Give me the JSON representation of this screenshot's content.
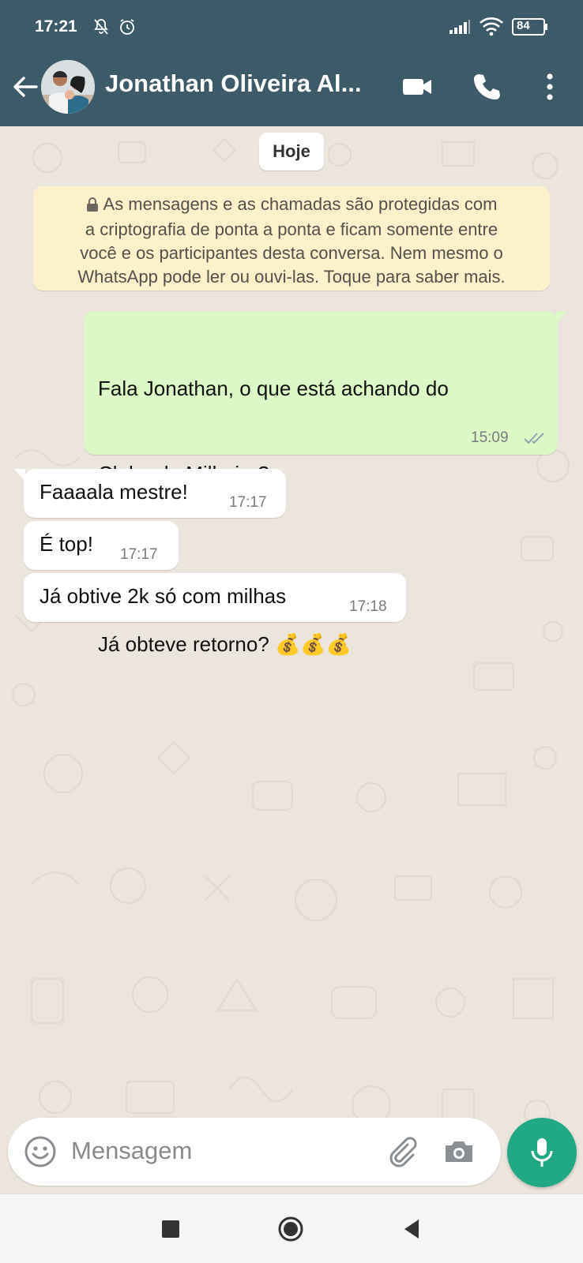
{
  "status_bar": {
    "time": "17:21",
    "battery": "84",
    "icons": [
      "bell-off-icon",
      "alarm-icon",
      "signal-icon",
      "wifi-icon",
      "battery-icon"
    ]
  },
  "header": {
    "contact_name": "Jonathan Oliveira Al...",
    "icons": [
      "back-arrow-icon",
      "video-call-icon",
      "phone-icon",
      "more-vert-icon"
    ]
  },
  "chat": {
    "date_chip": "Hoje",
    "encryption_notice": {
      "lines": [
        "As mensagens e as chamadas são protegidas com",
        "a criptografia de ponta a ponta e ficam somente entre",
        "você e os participantes desta conversa. Nem mesmo o",
        "WhatsApp pode ler ou ouvi-las. Toque para saber mais."
      ]
    },
    "messages": [
      {
        "direction": "outgoing",
        "lines": [
          "Fala Jonathan, o que está achando do",
          "Clube do Milheiro?",
          "",
          "Já obteve retorno? 💰💰💰"
        ],
        "time": "15:09",
        "status": "read"
      },
      {
        "direction": "incoming",
        "text": "Faaaala mestre!",
        "time": "17:17"
      },
      {
        "direction": "incoming",
        "text": "É top!",
        "time": "17:17"
      },
      {
        "direction": "incoming",
        "text": "Já obtive 2k só com milhas",
        "time": "17:18"
      }
    ]
  },
  "composer": {
    "placeholder": "Mensagem",
    "icons": [
      "emoji-icon",
      "attach-icon",
      "camera-icon",
      "mic-icon"
    ]
  },
  "colors": {
    "header": "#3d5a68",
    "chat_background": "#ece5dd",
    "outgoing_bubble": "#dcf8c6",
    "incoming_bubble": "#ffffff",
    "encryption_notice": "#fdf1cc",
    "mic_button": "#21a884",
    "read_ticks": "#8fa4b0"
  }
}
